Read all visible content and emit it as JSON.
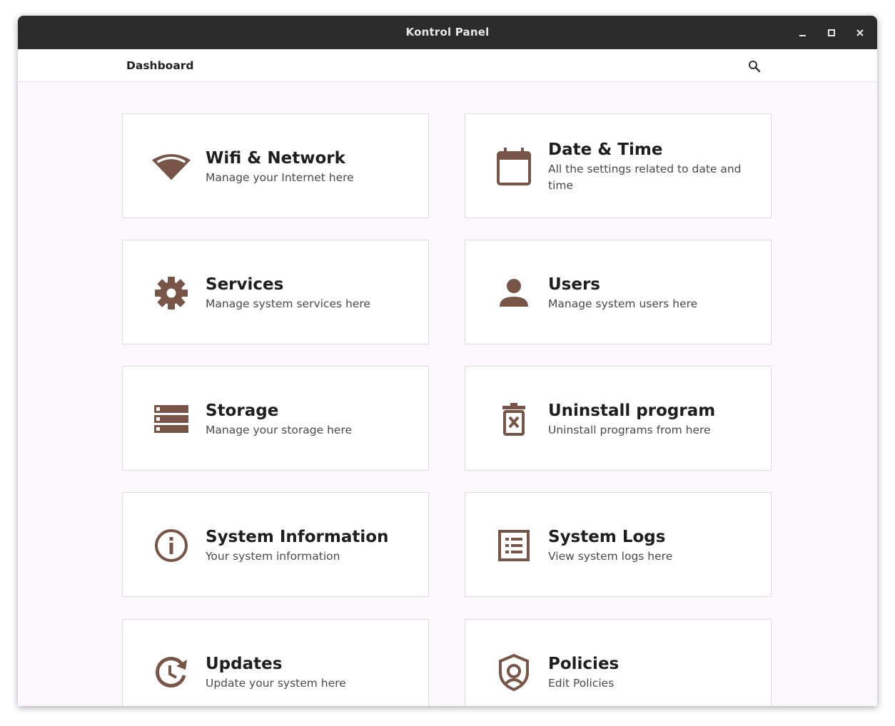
{
  "window": {
    "title": "Kontrol Panel"
  },
  "toolbar": {
    "breadcrumb": "Dashboard"
  },
  "colors": {
    "accent": "#795548",
    "titlebar": "#2b2b2b",
    "background": "#fdf8fb"
  },
  "cards": [
    {
      "title": "Wifi & Network",
      "subtitle": "Manage your Internet here",
      "icon": "wifi-icon"
    },
    {
      "title": "Date & Time",
      "subtitle": "All the settings related to date and time",
      "icon": "calendar-icon"
    },
    {
      "title": "Services",
      "subtitle": "Manage system services here",
      "icon": "gear-icon"
    },
    {
      "title": "Users",
      "subtitle": "Manage system users here",
      "icon": "user-icon"
    },
    {
      "title": "Storage",
      "subtitle": "Manage your storage here",
      "icon": "storage-icon"
    },
    {
      "title": "Uninstall program",
      "subtitle": "Uninstall programs from here",
      "icon": "trash-icon"
    },
    {
      "title": "System Information",
      "subtitle": "Your system information",
      "icon": "info-icon"
    },
    {
      "title": "System Logs",
      "subtitle": "View system logs here",
      "icon": "list-icon"
    },
    {
      "title": "Updates",
      "subtitle": "Update your system here",
      "icon": "update-icon"
    },
    {
      "title": "Policies",
      "subtitle": "Edit Policies",
      "icon": "shield-icon"
    }
  ]
}
